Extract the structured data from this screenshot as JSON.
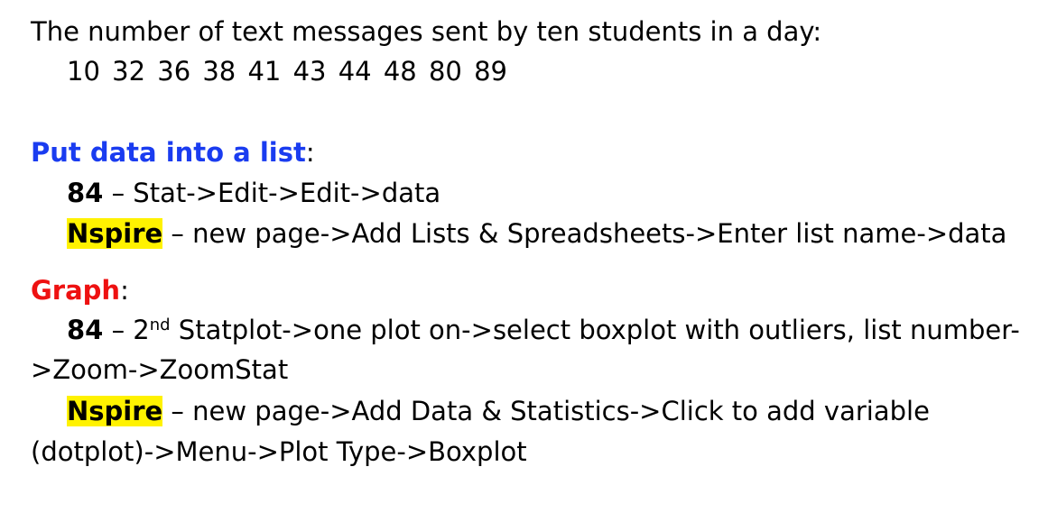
{
  "intro": "The number of text messages sent by ten students in a day:",
  "data_values": "10   32   36   38   41   43   44   48   80   89",
  "section1": {
    "heading": "Put data into a list",
    "colon": ":",
    "ti84_label": "84",
    "ti84_text": " – Stat->Edit->Edit->data",
    "nspire_label": "Nspire",
    "nspire_text": " – new page->Add Lists & Spreadsheets->Enter list name->data"
  },
  "section2": {
    "heading": "Graph",
    "colon": ":",
    "ti84_label": "84",
    "ti84_pre": " – 2",
    "ti84_sup": "nd",
    "ti84_text_a": " Statplot->one plot on->select boxplot with outliers, list number-",
    "ti84_text_b": ">Zoom->ZoomStat",
    "nspire_label": "Nspire",
    "nspire_text_a": " – new page->Add Data & Statistics->Click to add variable",
    "nspire_text_b": "(dotplot)->Menu->Plot Type->Boxplot"
  },
  "colors": {
    "heading1": "#1a3cf0",
    "heading2": "#ee1111",
    "highlight": "#fff200"
  }
}
